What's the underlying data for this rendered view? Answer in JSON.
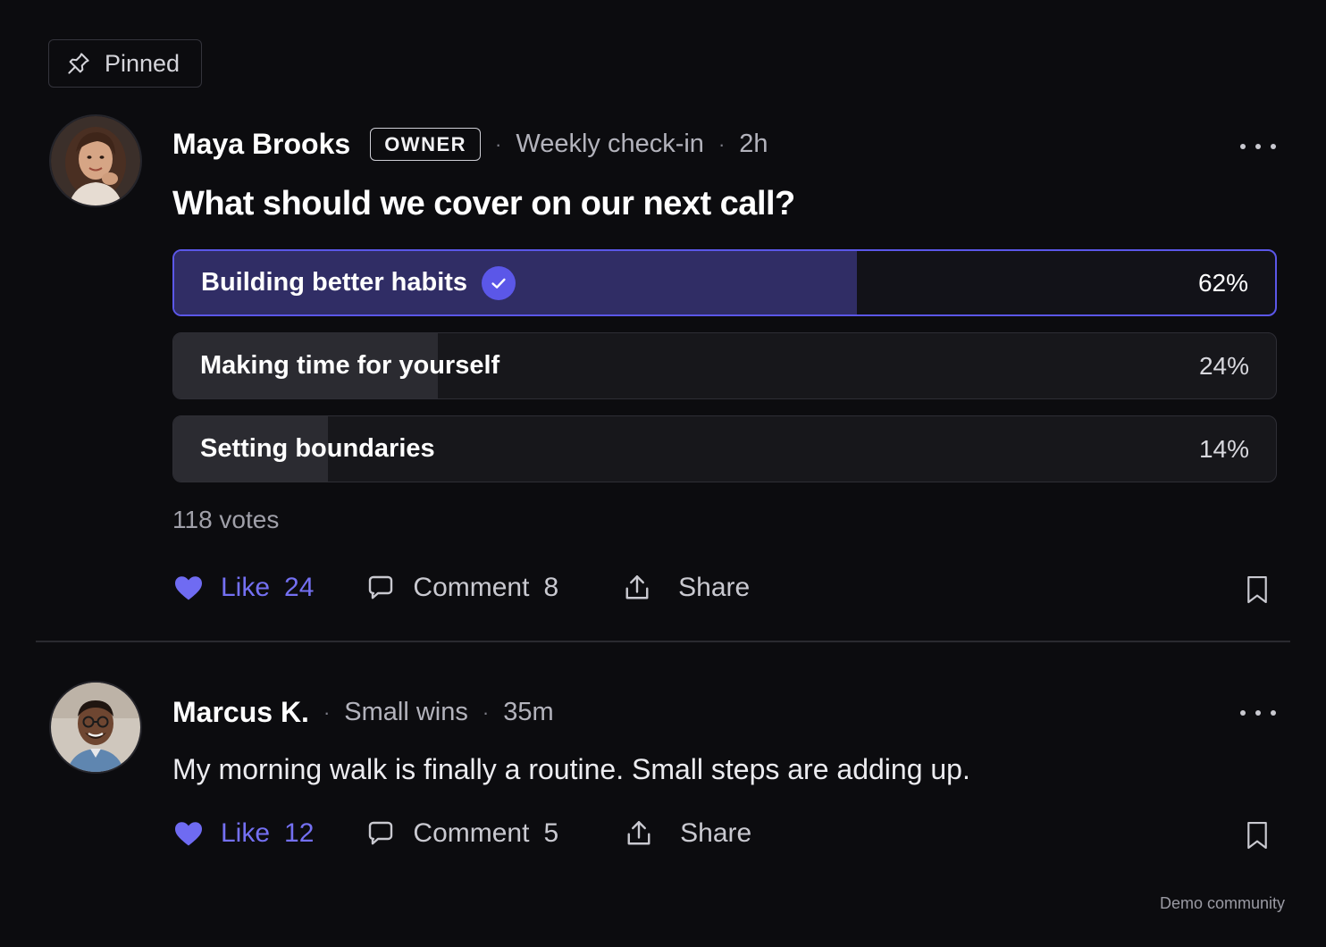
{
  "pinned": {
    "label": "Pinned",
    "icon": "pin-icon"
  },
  "posts": [
    {
      "author": "Maya Brooks",
      "badge": "OWNER",
      "category": "Weekly check-in",
      "time": "2h",
      "title": "What should we cover on our next call?",
      "poll": {
        "options": [
          {
            "label": "Building better habits",
            "percent_text": "62%",
            "percent": 62,
            "selected": true
          },
          {
            "label": "Making time for yourself",
            "percent_text": "24%",
            "percent": 24,
            "selected": false
          },
          {
            "label": "Setting boundaries",
            "percent_text": "14%",
            "percent": 14,
            "selected": false
          }
        ],
        "votes": "118 votes"
      },
      "actions": {
        "like_label": "Like",
        "like_count": "24",
        "liked": true,
        "comment_label": "Comment",
        "comment_count": "8",
        "share_label": "Share"
      }
    },
    {
      "author": "Marcus K.",
      "category": "Small wins",
      "time": "35m",
      "body": "My morning walk is finally a routine. Small steps are adding up.",
      "actions": {
        "like_label": "Like",
        "like_count": "12",
        "liked": true,
        "comment_label": "Comment",
        "comment_count": "5",
        "share_label": "Share"
      }
    }
  ],
  "footer": "Demo community",
  "colors": {
    "background": "#0c0c0f",
    "accent": "#5b57e8",
    "like": "#7470f2",
    "selected_fill": "#302d65",
    "option_fill": "#2b2b31"
  }
}
